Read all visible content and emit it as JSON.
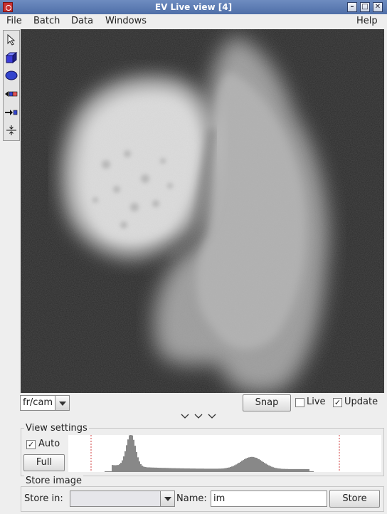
{
  "window": {
    "title": "EV Live view [4]"
  },
  "menu": [
    "File",
    "Batch",
    "Data",
    "Windows",
    "Help"
  ],
  "tools": [
    {
      "icon": "select-arrow-icon"
    },
    {
      "icon": "cube-icon"
    },
    {
      "icon": "ellipse-icon"
    },
    {
      "icon": "channel-left-icon"
    },
    {
      "icon": "channel-right-icon"
    },
    {
      "icon": "split-icon"
    }
  ],
  "controls": {
    "channel_value": "fr/cam",
    "snap_label": "Snap",
    "live_label": "Live",
    "live_checked": false,
    "update_label": "Update",
    "update_checked": true,
    "collapse_glyph": "⌄ ⌄ ⌄"
  },
  "view_settings": {
    "title": "View settings",
    "auto_label": "Auto",
    "auto_checked": true,
    "full_label": "Full"
  },
  "store_image": {
    "title": "Store image",
    "store_in_label": "Store in:",
    "store_in_value": "",
    "name_label": "Name:",
    "name_value": "im",
    "store_button": "Store"
  },
  "colors": {
    "titlebar": "#5577b0",
    "image_background": "#2d2d2d",
    "histogram_marker": "#d04040"
  }
}
